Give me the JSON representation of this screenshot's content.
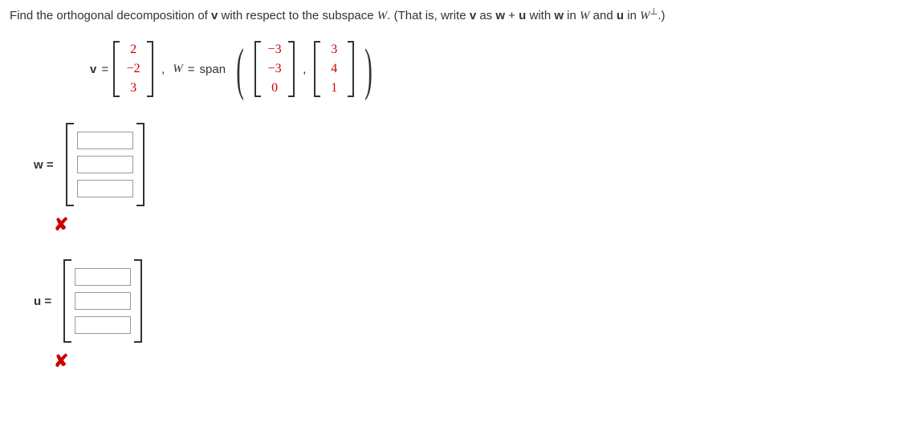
{
  "question": {
    "prefix": "Find the orthogonal decomposition of ",
    "v": "v",
    "mid1": " with respect to the subspace ",
    "W": "W",
    "mid2": ". (That is, write ",
    "v2": "v",
    "mid3": " as ",
    "w": "w",
    "plus": " + ",
    "u": "u",
    "mid4": " with ",
    "w2": "w",
    "mid5": " in ",
    "W2": "W",
    "mid6": " and ",
    "u2": "u",
    "mid7": " in ",
    "W3": "W",
    "perp": "⊥",
    "end": ".)"
  },
  "equation": {
    "v_label": "v",
    "eq1": " = ",
    "v_vec": [
      "2",
      "−2",
      "3"
    ],
    "comma1": ",",
    "W_label": "W",
    "eq2": " = ",
    "span": "span",
    "b1": [
      "−3",
      "−3",
      "0"
    ],
    "comma2": ",",
    "b2": [
      "3",
      "4",
      "1"
    ]
  },
  "answers": {
    "w_label": "w",
    "u_label": "u",
    "eq": " = "
  },
  "marks": {
    "cross": "✘"
  },
  "chart_data": {
    "type": "table",
    "description": "Linear algebra orthogonal decomposition problem",
    "vector_v": [
      2,
      -2,
      3
    ],
    "subspace_W_basis": [
      [
        -3,
        -3,
        0
      ],
      [
        3,
        4,
        1
      ]
    ],
    "answer_w": [
      "",
      "",
      ""
    ],
    "answer_u": [
      "",
      "",
      ""
    ],
    "grading": {
      "w": "incorrect",
      "u": "incorrect"
    }
  }
}
